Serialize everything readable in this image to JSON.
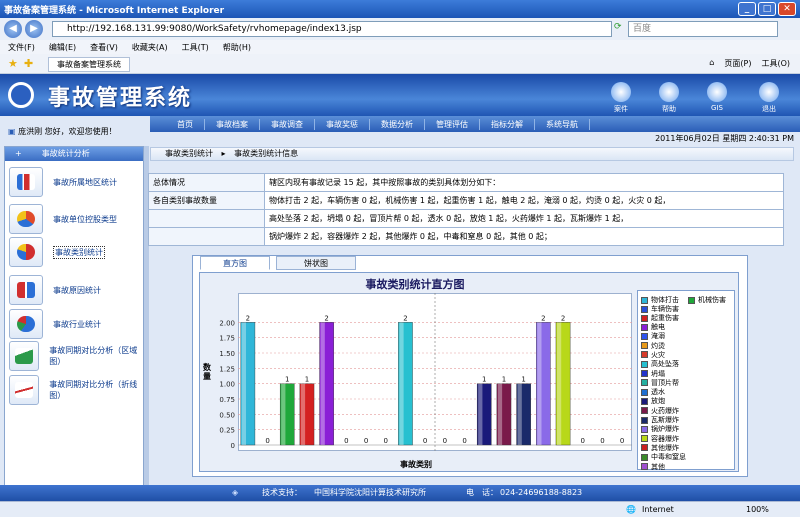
{
  "window": {
    "title": "事故备案管理系统 - Microsoft Internet Explorer"
  },
  "browser": {
    "url": "http://192.168.131.99:9080/WorkSafety/rvhomepage/index13.jsp",
    "search_placeholder": "百度",
    "menu": [
      "文件(F)",
      "编辑(E)",
      "查看(V)",
      "收藏夹(A)",
      "工具(T)",
      "帮助(H)"
    ],
    "tab_title": "事故备案管理系统",
    "toolbar_right": [
      "页面(P)",
      "工具(O)"
    ]
  },
  "header": {
    "title": "事故管理系统",
    "buttons": [
      "案件",
      "帮助",
      "GIS",
      "退出"
    ]
  },
  "welcome": "庞洪刚 您好，欢迎您使用！",
  "nav": [
    "首页",
    "事故档案",
    "事故调查",
    "事故奖惩",
    "数据分析",
    "管理评估",
    "指标分解",
    "系统导航"
  ],
  "datetime": "2011年06月02日 星期四 2:40:31 PM",
  "sidebar": {
    "header": "事故统计分析",
    "items": [
      {
        "label": "事故所属地区统计",
        "icon": "bar-chart-icon",
        "color": "#2b6fd6"
      },
      {
        "label": "事故单位控股类型",
        "icon": "pie-chart-icon",
        "color": "#e04b2a"
      },
      {
        "label": "事故类别统计",
        "icon": "pie-chart-icon",
        "color": "#d12f2f"
      },
      {
        "label": "事故原因统计",
        "icon": "bar-chart-icon",
        "color": "#d12f2f"
      },
      {
        "label": "事故行业统计",
        "icon": "pie-chart-icon",
        "color": "#2b6fd6"
      },
      {
        "label": "事故同期对比分析（区域图）",
        "icon": "area-chart-icon",
        "color": "#2b9a4a"
      },
      {
        "label": "事故同期对比分析（折线图）",
        "icon": "line-chart-icon",
        "color": "#d12f2f"
      }
    ]
  },
  "breadcrumb": [
    "事故类别统计",
    "事故类别统计信息"
  ],
  "summary": {
    "label_overall": "总体情况",
    "overall": "辖区内现有事故记录 15 起，其中按照事故的类别具体划分如下：",
    "label_counts": "各自类别事故数量",
    "lines": [
      "物体打击 2 起，车辆伤害 0 起，机械伤害 1 起，起重伤害 1 起，触电 2 起，淹溺 0 起，灼烫 0 起，火灾 0 起，",
      "高处坠落 2 起，坍塌 0 起，冒顶片帮 0 起，透水 0 起，放炮 1 起，火药爆炸 1 起，瓦斯爆炸 1 起，",
      "锅炉爆炸 2 起，容器爆炸 2 起，其他爆炸 0 起，中毒和窒息 0 起，其他 0 起；"
    ]
  },
  "tabs": [
    "直方图",
    "饼状图"
  ],
  "chart_data": {
    "type": "bar",
    "title": "事故类别统计直方图",
    "xlabel": "事故类别",
    "ylabel": "数量",
    "ylim": [
      0,
      2.25
    ],
    "yticks": [
      "0",
      "0.25",
      "0.50",
      "0.75",
      "1.00",
      "1.25",
      "1.50",
      "1.75",
      "2.00"
    ],
    "categories": [
      "物体打击",
      "车辆伤害",
      "机械伤害",
      "起重伤害",
      "触电",
      "淹溺",
      "灼烫",
      "火灾",
      "高处坠落",
      "坍塌",
      "冒顶片帮",
      "透水",
      "放炮",
      "火药爆炸",
      "瓦斯爆炸",
      "锅炉爆炸",
      "容器爆炸",
      "其他爆炸",
      "中毒和窒息",
      "其他"
    ],
    "values": [
      2,
      0,
      1,
      1,
      2,
      0,
      0,
      0,
      2,
      0,
      0,
      0,
      1,
      1,
      1,
      2,
      2,
      0,
      0,
      0
    ],
    "colors": [
      "#2fb6d8",
      "#2a4fd8",
      "#1fa83a",
      "#d42020",
      "#8a1fd6",
      "#2f55ee",
      "#e89a1a",
      "#d63a2a",
      "#27c0d0",
      "#2233cc",
      "#26b0a0",
      "#1f6fd0",
      "#1a1a7a",
      "#7a1a4a",
      "#1a2a6a",
      "#8a6ae8",
      "#b8d81a",
      "#c82020",
      "#3a8a2a",
      "#a050d0"
    ],
    "legend": "right"
  },
  "footer": {
    "support_label": "技术支持：",
    "org": "中国科学院沈阳计算技术研究所",
    "phone_label": "电　话：",
    "phone": "024-24696188-8823"
  },
  "status": {
    "zone": "Internet",
    "zoom": "100%"
  }
}
